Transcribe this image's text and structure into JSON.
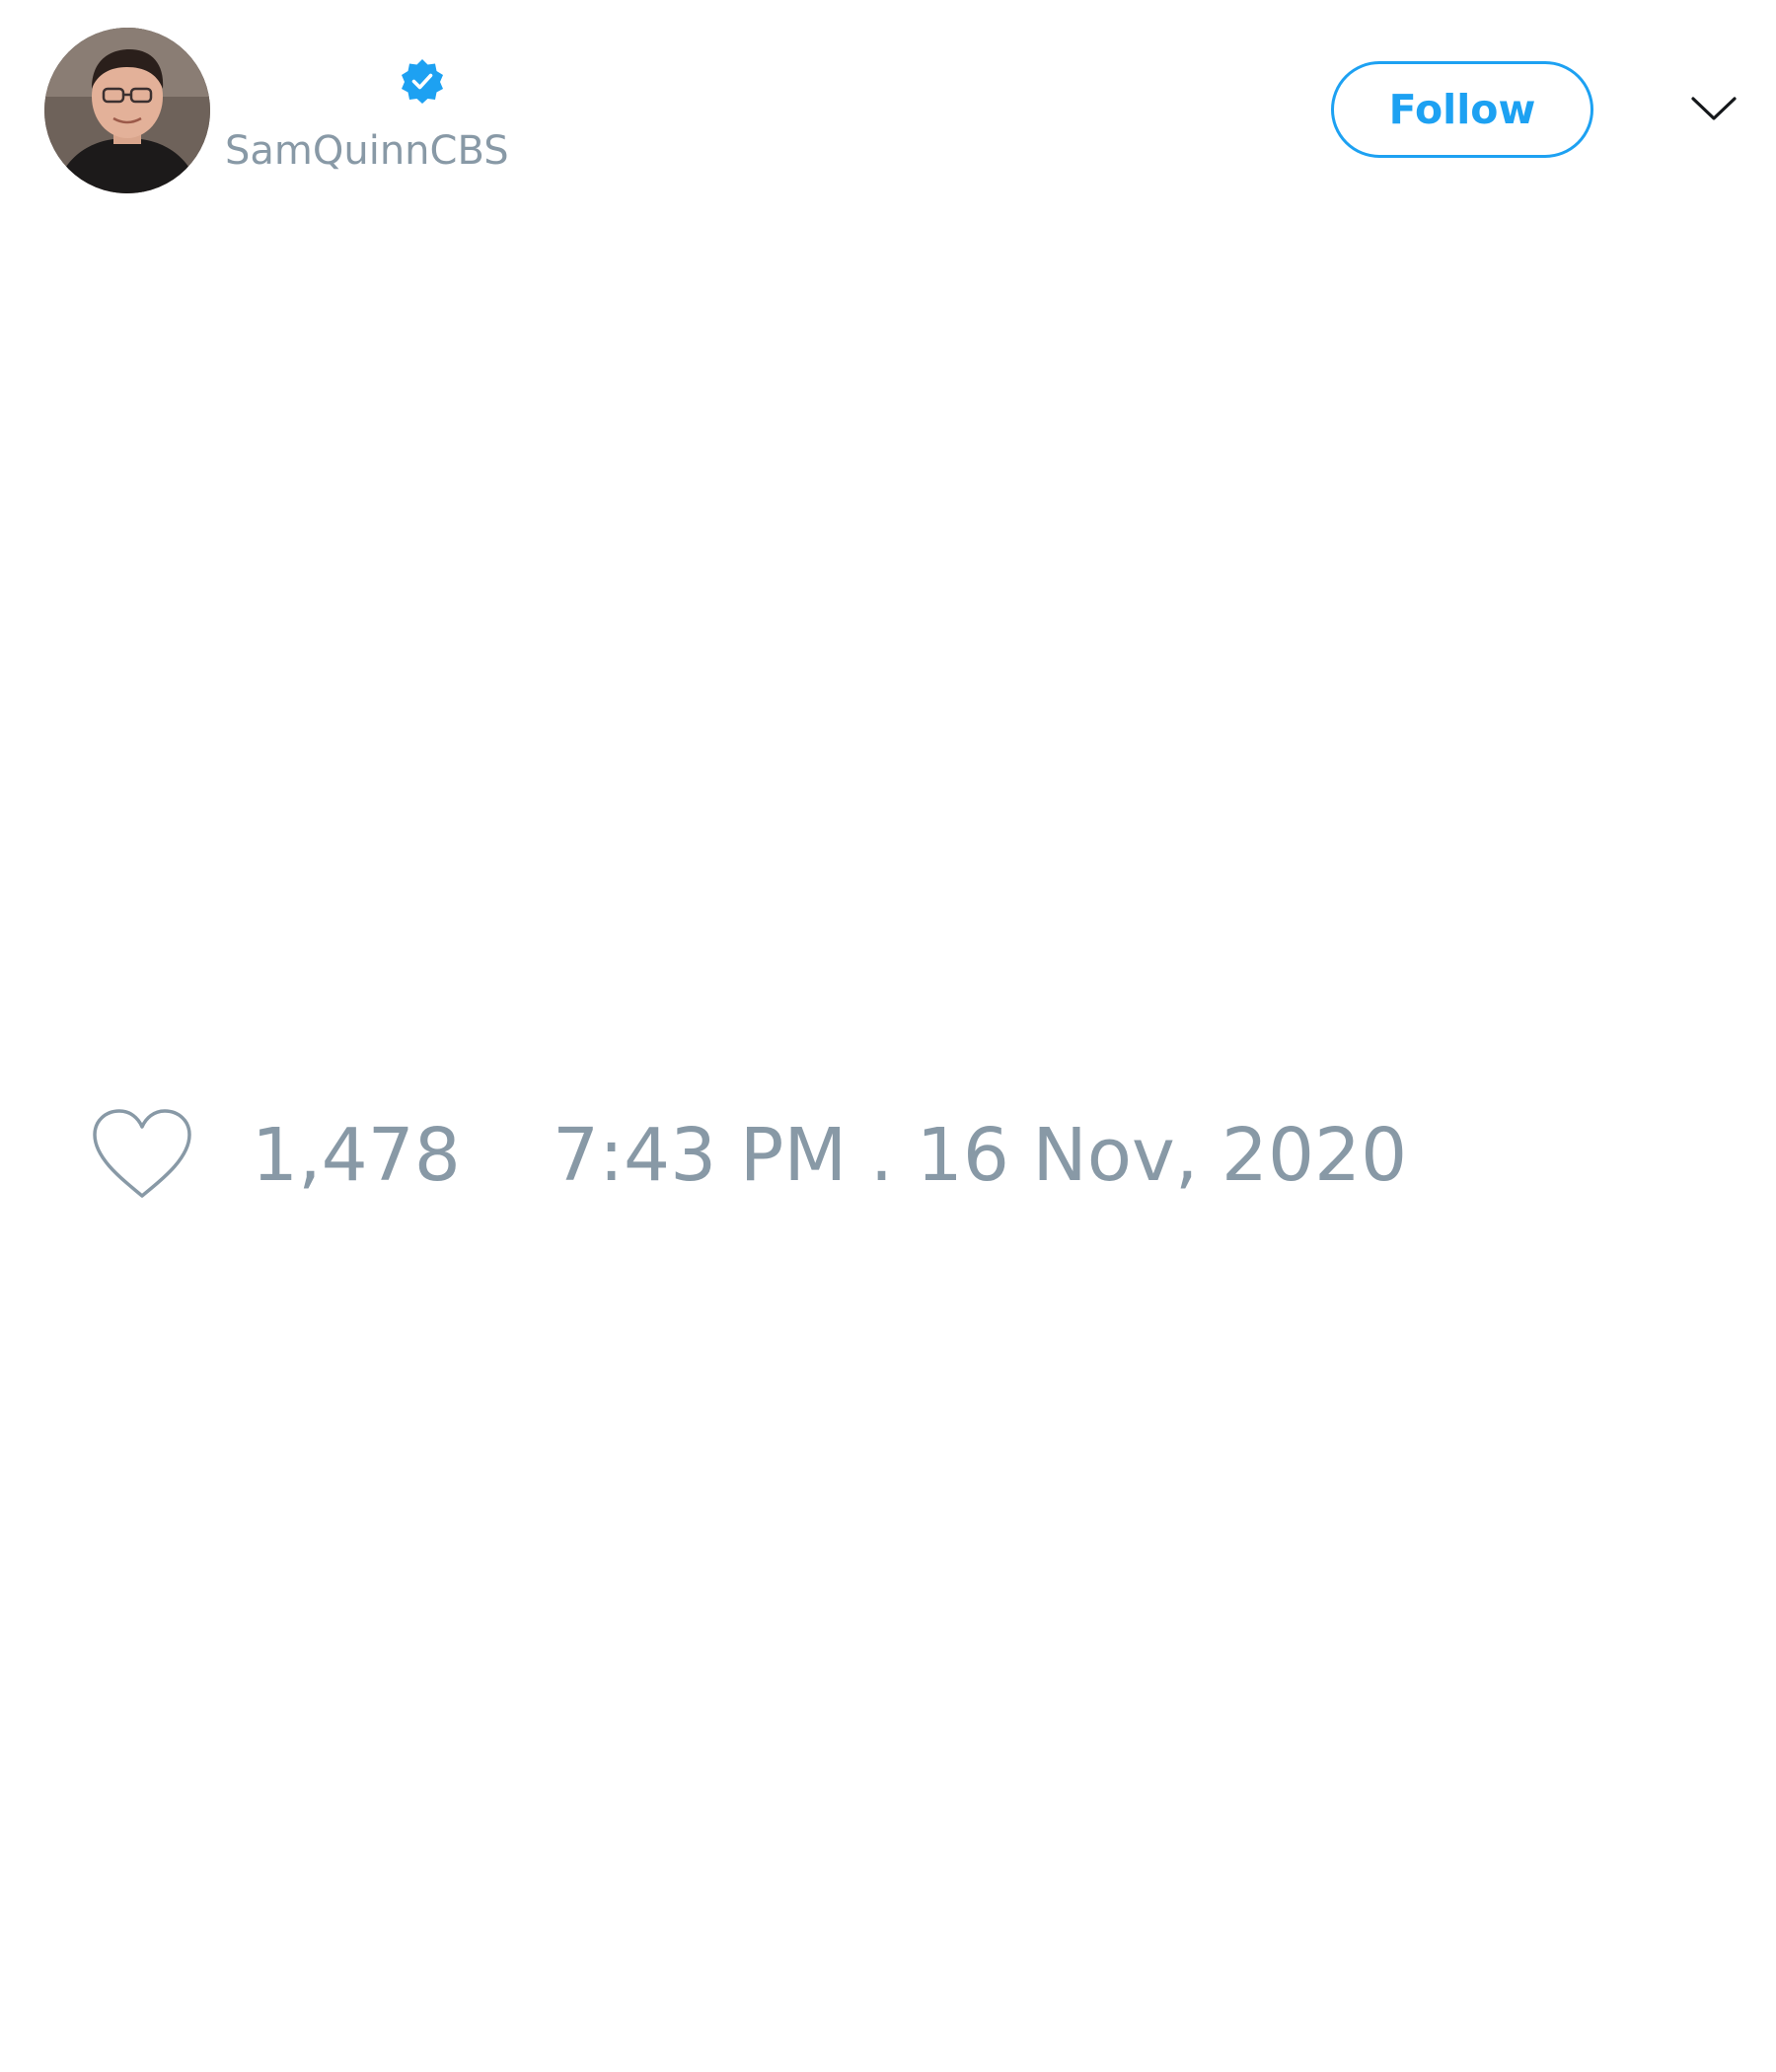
{
  "header": {
    "handle": "SamQuinnCBS",
    "follow_label": "Follow",
    "avatar": "profile-photo",
    "verified_icon": "verified-badge-icon",
    "menu_icon": "chevron-down-icon"
  },
  "footer": {
    "like_icon": "heart-outline-icon",
    "like_count": "1,478",
    "timestamp": "7:43 PM . 16 Nov, 2020"
  },
  "colors": {
    "accent": "#1da1f2",
    "muted_text": "#8899a6",
    "background": "#ffffff"
  }
}
